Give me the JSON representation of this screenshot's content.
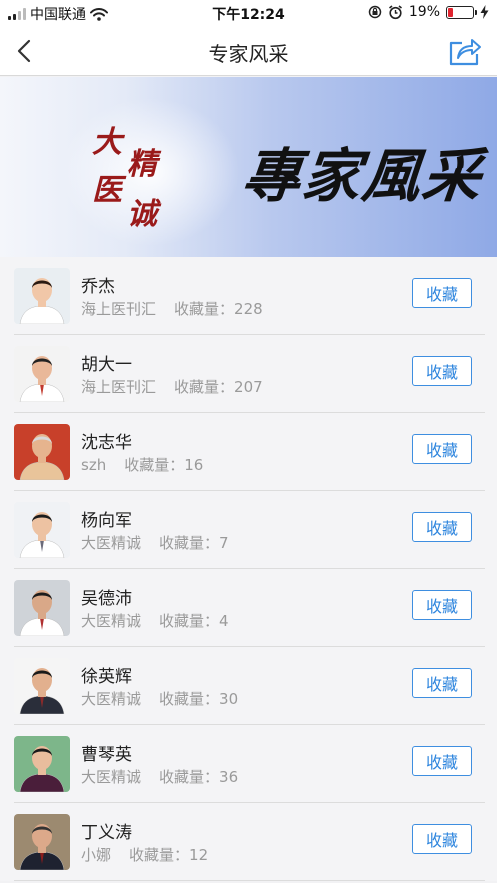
{
  "status_bar": {
    "carrier": "中国联通",
    "time": "下午12:24",
    "battery": "19%",
    "battery_level": 0.19
  },
  "nav": {
    "title": "专家风采"
  },
  "banner": {
    "small_chars": [
      "大",
      "医",
      "精",
      "诚"
    ],
    "big_text": "專家風采"
  },
  "experts": [
    {
      "name": "乔杰",
      "source": "海上医刊汇",
      "fav_label": "收藏量：",
      "fav_count": "228",
      "button": "收藏"
    },
    {
      "name": "胡大一",
      "source": "海上医刊汇",
      "fav_label": "收藏量：",
      "fav_count": "207",
      "button": "收藏"
    },
    {
      "name": "沈志华",
      "source": "szh",
      "fav_label": "收藏量：",
      "fav_count": "16",
      "button": "收藏"
    },
    {
      "name": "杨向军",
      "source": "大医精诚",
      "fav_label": "收藏量：",
      "fav_count": "7",
      "button": "收藏"
    },
    {
      "name": "吴德沛",
      "source": "大医精诚",
      "fav_label": "收藏量：",
      "fav_count": "4",
      "button": "收藏"
    },
    {
      "name": "徐英辉",
      "source": "大医精诚",
      "fav_label": "收藏量：",
      "fav_count": "30",
      "button": "收藏"
    },
    {
      "name": "曹琴英",
      "source": "大医精诚",
      "fav_label": "收藏量：",
      "fav_count": "36",
      "button": "收藏"
    },
    {
      "name": "丁义涛",
      "source": "小娜",
      "fav_label": "收藏量：",
      "fav_count": "12",
      "button": "收藏"
    }
  ],
  "colors": {
    "accent": "#2f86de",
    "banner_red": "#9a1a1a",
    "battery_low": "#e0242f"
  }
}
